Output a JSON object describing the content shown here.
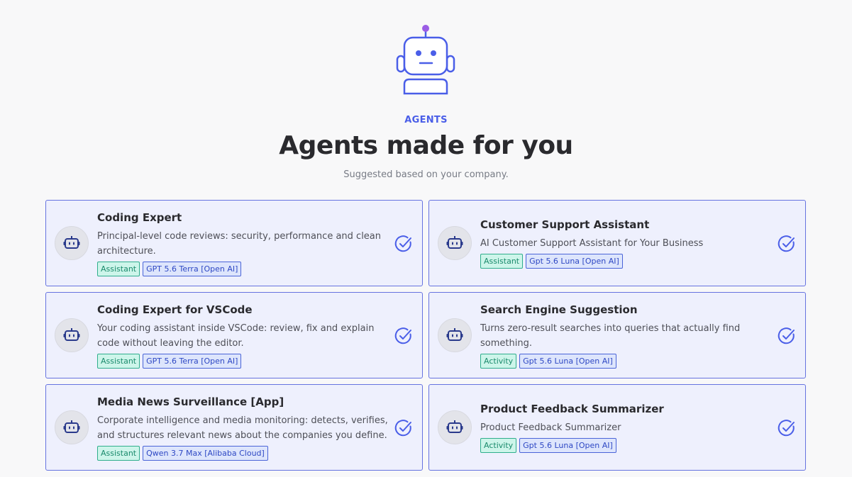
{
  "header": {
    "eyebrow": "AGENTS",
    "title": "Agents made for you",
    "subtitle": "Suggested based on your company."
  },
  "colors": {
    "accent": "#4a5ee8",
    "type_tag": "#2fae8c",
    "model_tag": "#4a64d8",
    "antenna": "#9b5de5"
  },
  "agents": [
    {
      "title": "Coding Expert",
      "description": "Principal-level code reviews: security, performance and clean architecture.",
      "type": "Assistant",
      "model": "GPT 5.6 Terra [Open AI]",
      "selected": true,
      "icon": "robot-icon"
    },
    {
      "title": "Customer Support Assistant",
      "description": "AI Customer Support Assistant for Your Business",
      "type": "Assistant",
      "model": "Gpt 5.6 Luna [Open AI]",
      "selected": true,
      "icon": "robot-icon"
    },
    {
      "title": "Coding Expert for VSCode",
      "description": "Your coding assistant inside VSCode: review, fix and explain code without leaving the editor.",
      "type": "Assistant",
      "model": "GPT 5.6 Terra [Open AI]",
      "selected": true,
      "icon": "robot-icon"
    },
    {
      "title": "Search Engine Suggestion",
      "description": "Turns zero-result searches into queries that actually find something.",
      "type": "Activity",
      "model": "Gpt 5.6 Luna [Open AI]",
      "selected": true,
      "icon": "robot-icon"
    },
    {
      "title": "Media News Surveillance [App]",
      "description": "Corporate intelligence and media monitoring: detects, verifies, and structures relevant news about the companies you define.",
      "type": "Assistant",
      "model": "Qwen 3.7 Max [Alibaba Cloud]",
      "selected": true,
      "icon": "robot-icon"
    },
    {
      "title": "Product Feedback Summarizer",
      "description": "Product Feedback Summarizer",
      "type": "Activity",
      "model": "Gpt 5.6 Luna [Open AI]",
      "selected": true,
      "icon": "robot-icon"
    }
  ]
}
